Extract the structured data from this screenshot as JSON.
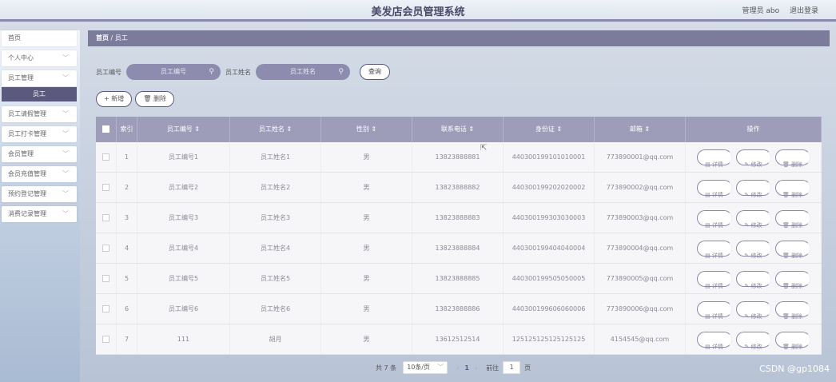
{
  "header": {
    "title": "美发店会员管理系统",
    "user_label": "管理员 abo",
    "logout_label": "退出登录"
  },
  "sidebar": {
    "items": [
      {
        "label": "首页",
        "has_chevron": false
      },
      {
        "label": "个人中心",
        "has_chevron": true
      },
      {
        "label": "员工管理",
        "has_chevron": true
      },
      {
        "label": "员工请假管理",
        "has_chevron": true
      },
      {
        "label": "员工打卡管理",
        "has_chevron": true
      },
      {
        "label": "会员管理",
        "has_chevron": true
      },
      {
        "label": "会员充值管理",
        "has_chevron": true
      },
      {
        "label": "预约登记管理",
        "has_chevron": true
      },
      {
        "label": "消费记录管理",
        "has_chevron": true
      }
    ],
    "active_sub": "员工"
  },
  "breadcrumb": {
    "home": "首页",
    "sep": "/",
    "current": "员工"
  },
  "search": {
    "field1_label": "员工编号",
    "field1_placeholder": "员工编号",
    "field2_label": "员工姓名",
    "field2_placeholder": "员工姓名",
    "query_label": "查询"
  },
  "actions": {
    "add_label": "+ 新增",
    "delete_label": "删除"
  },
  "table": {
    "headers": [
      "索引",
      "员工编号 ⇕",
      "员工姓名 ⇕",
      "性别 ⇕",
      "联系电话 ⇕",
      "身份证 ⇕",
      "邮箱 ⇕",
      "操作"
    ],
    "rows": [
      {
        "index": "1",
        "code": "员工编号1",
        "name": "员工姓名1",
        "gender": "男",
        "phone": "13823888881",
        "id": "440300199101010001",
        "email": "773890001@qq.com"
      },
      {
        "index": "2",
        "code": "员工编号2",
        "name": "员工姓名2",
        "gender": "男",
        "phone": "13823888882",
        "id": "440300199202020002",
        "email": "773890002@qq.com"
      },
      {
        "index": "3",
        "code": "员工编号3",
        "name": "员工姓名3",
        "gender": "男",
        "phone": "13823888883",
        "id": "440300199303030003",
        "email": "773890003@qq.com"
      },
      {
        "index": "4",
        "code": "员工编号4",
        "name": "员工姓名4",
        "gender": "男",
        "phone": "13823888884",
        "id": "440300199404040004",
        "email": "773890004@qq.com"
      },
      {
        "index": "5",
        "code": "员工编号5",
        "name": "员工姓名5",
        "gender": "男",
        "phone": "13823888885",
        "id": "440300199505050005",
        "email": "773890005@qq.com"
      },
      {
        "index": "6",
        "code": "员工编号6",
        "name": "员工姓名6",
        "gender": "男",
        "phone": "13823888886",
        "id": "440300199606060006",
        "email": "773890006@qq.com"
      },
      {
        "index": "7",
        "code": "111",
        "name": "胡月",
        "gender": "男",
        "phone": "13612512514",
        "id": "125125125125125125",
        "email": "4154545@qq.com"
      }
    ],
    "op_labels": {
      "detail": "详情",
      "edit": "修改",
      "delete": "删除"
    }
  },
  "pagination": {
    "total_label": "共 7 条",
    "page_size": "10条/页",
    "current_page": "1",
    "goto_label": "前往",
    "goto_value": "1",
    "page_suffix": "页"
  },
  "watermark": "CSDN @gp1084"
}
